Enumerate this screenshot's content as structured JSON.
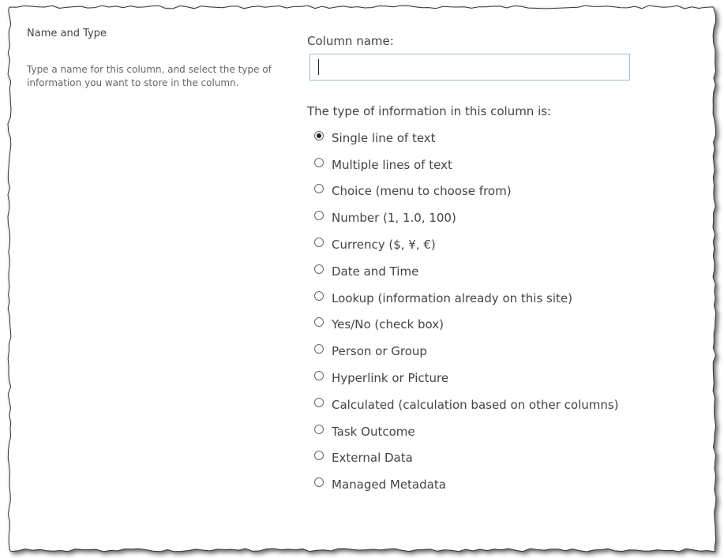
{
  "section": {
    "title": "Name and Type",
    "description": "Type a name for this column, and select the type of information you want to store in the column."
  },
  "column_name": {
    "label": "Column name:",
    "value": ""
  },
  "type": {
    "label": "The type of information in this column is:",
    "selected": "Single line of text",
    "options": [
      "Single line of text",
      "Multiple lines of text",
      "Choice (menu to choose from)",
      "Number (1, 1.0, 100)",
      "Currency ($, ¥, €)",
      "Date and Time",
      "Lookup (information already on this site)",
      "Yes/No (check box)",
      "Person or Group",
      "Hyperlink or Picture",
      "Calculated (calculation based on other columns)",
      "Task Outcome",
      "External Data",
      "Managed Metadata"
    ]
  }
}
